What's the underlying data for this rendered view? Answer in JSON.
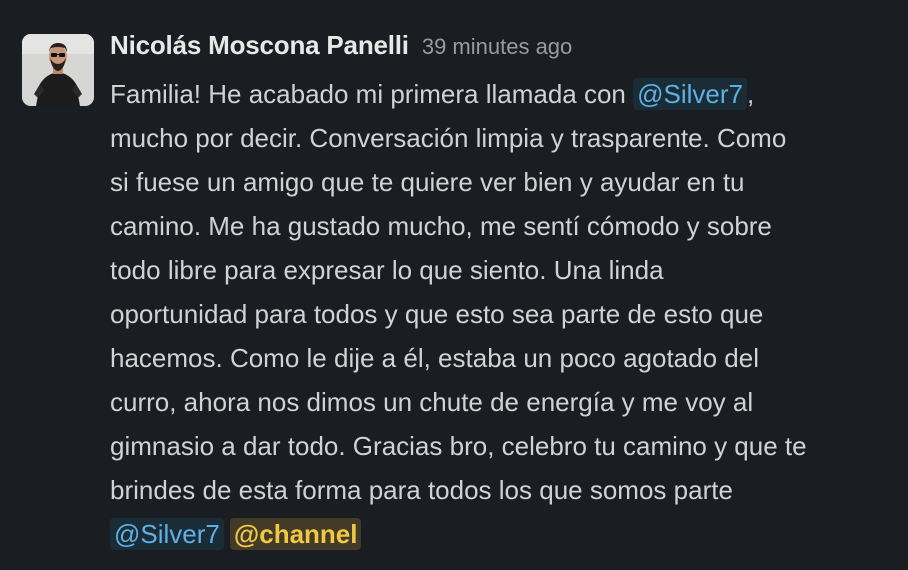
{
  "message": {
    "author": "Nicolás Moscona Panelli",
    "timestamp": "39 minutes ago",
    "avatar_icon": "user-photo-avatar",
    "lines": [
      {
        "before": "Familia! He acabado mi primera llamada con ",
        "mention": "@Silver7",
        "after": ","
      },
      {
        "text": "mucho por decir. Conversación limpia y trasparente. Como"
      },
      {
        "text": "si fuese un amigo que te quiere ver bien y ayudar en tu"
      },
      {
        "text": "camino. Me ha gustado mucho, me sentí cómodo y sobre"
      },
      {
        "text": "todo libre para expresar lo que siento. Una linda"
      },
      {
        "text": "oportunidad para todos y que esto sea parte de esto que"
      },
      {
        "text": "hacemos. Como le dije a él, estaba un poco agotado del"
      },
      {
        "text": "curro, ahora nos dimos un chute de energía y me voy al"
      },
      {
        "text": "gimnasio a dar todo. Gracias bro, celebro tu camino y que te"
      },
      {
        "text": "brindes de esta forma para todos los que somos parte"
      },
      {
        "mention": "@Silver7",
        "channel_mention": "@channel"
      }
    ]
  },
  "colors": {
    "background": "#1a1d21",
    "text": "#d1d2d3",
    "user_mention": "#5fb0e3",
    "channel_mention": "#f2c744"
  }
}
